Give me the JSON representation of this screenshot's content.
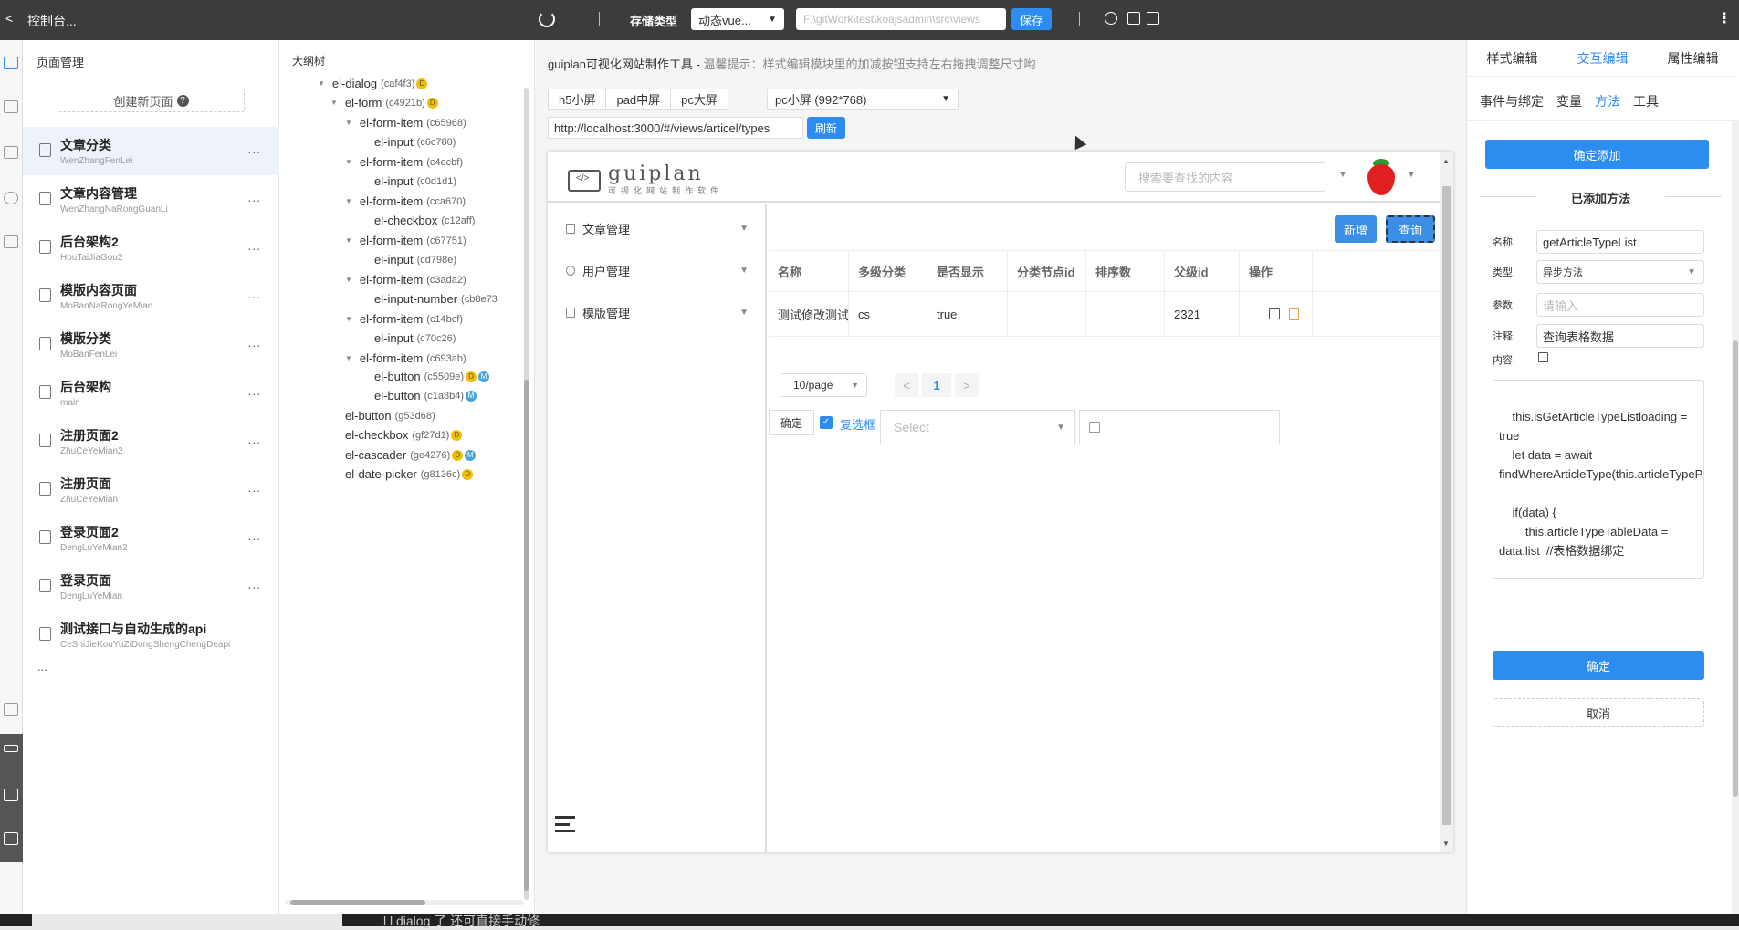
{
  "topbar": {
    "back": "<",
    "title": "控制台...",
    "storage_label": "存储类型",
    "storage_value": "动态vue...",
    "path_value": "F:\\gitWork\\test\\koajsadmin\\src\\views",
    "save": "保存",
    "more": "⋮"
  },
  "pages": {
    "title": "页面管理",
    "create": "创建新页面",
    "help": "?",
    "items": [
      {
        "name": "文章分类",
        "code": "WenZhangFenLei",
        "more": "..."
      },
      {
        "name": "文章内容管理",
        "code": "WenZhangNaRongGuanLi",
        "more": "..."
      },
      {
        "name": "后台架构2",
        "code": "HouTaiJiaGou2",
        "more": "..."
      },
      {
        "name": "模版内容页面",
        "code": "MoBanNaRongYeMian",
        "more": "..."
      },
      {
        "name": "模版分类",
        "code": "MoBanFenLei",
        "more": "..."
      },
      {
        "name": "后台架构",
        "code": "main",
        "more": "..."
      },
      {
        "name": "注册页面2",
        "code": "ZhuCeYeMian2",
        "more": "..."
      },
      {
        "name": "注册页面",
        "code": "ZhuCeYeMian",
        "more": "..."
      },
      {
        "name": "登录页面2",
        "code": "DengLuYeMian2",
        "more": "..."
      },
      {
        "name": "登录页面",
        "code": "DengLuYeMian",
        "more": "..."
      },
      {
        "name": "测试接口与自动生成的api",
        "code": "CeShiJieKouYuZiDongShengChengDeapi",
        "more": ""
      }
    ],
    "ellipsis": "..."
  },
  "tree": {
    "title": "大纲树",
    "nodes": [
      {
        "label": "el-dialog",
        "id": "(caf4f3)",
        "badges": [
          "D"
        ]
      },
      {
        "label": "el-form",
        "id": "(c4921b)",
        "badges": [
          "D"
        ]
      },
      {
        "label": "el-form-item",
        "id": "(c65968)",
        "badges": []
      },
      {
        "label": "el-input",
        "id": "(c6c780)",
        "badges": []
      },
      {
        "label": "el-form-item",
        "id": "(c4ecbf)",
        "badges": []
      },
      {
        "label": "el-input",
        "id": "(c0d1d1)",
        "badges": []
      },
      {
        "label": "el-form-item",
        "id": "(cca670)",
        "badges": []
      },
      {
        "label": "el-checkbox",
        "id": "(c12aff)",
        "badges": []
      },
      {
        "label": "el-form-item",
        "id": "(c67751)",
        "badges": []
      },
      {
        "label": "el-input",
        "id": "(cd798e)",
        "badges": []
      },
      {
        "label": "el-form-item",
        "id": "(c3ada2)",
        "badges": []
      },
      {
        "label": "el-input-number",
        "id": "(cb8e73",
        "badges": []
      },
      {
        "label": "el-form-item",
        "id": "(c14bcf)",
        "badges": []
      },
      {
        "label": "el-input",
        "id": "(c70c26)",
        "badges": []
      },
      {
        "label": "el-form-item",
        "id": "(c693ab)",
        "badges": []
      },
      {
        "label": "el-button",
        "id": "(c5509e)",
        "badges": [
          "D",
          "M"
        ]
      },
      {
        "label": "el-button",
        "id": "(c1a8b4)",
        "badges": [
          "M"
        ]
      },
      {
        "label": "el-button",
        "id": "(g53d68)",
        "badges": []
      },
      {
        "label": "el-checkbox",
        "id": "(gf27d1)",
        "badges": [
          "D"
        ]
      },
      {
        "label": "el-cascader",
        "id": "(ge4276)",
        "badges": [
          "D",
          "M"
        ]
      },
      {
        "label": "el-date-picker",
        "id": "(g8136c)",
        "badges": [
          "D"
        ]
      }
    ]
  },
  "canvas": {
    "tool_title": "guiplan可视化网站制作工具 - ",
    "hint": "温馨提示：样式编辑模块里的加减按钮支持左右拖拽调整尺寸哟",
    "device_tabs": [
      "h5小屏",
      "pad中屏",
      "pc大屏"
    ],
    "device_select": "pc小屏 (992*768)",
    "url": "http://localhost:3000/#/views/articel/types",
    "refresh": "刷新"
  },
  "preview": {
    "brand": "guiplan",
    "brand_sub": "可视化网站制作软件",
    "search_placeholder": "搜索要查找的内容",
    "menus": [
      "文章管理",
      "用户管理",
      "模版管理"
    ],
    "add": "新增",
    "query": "查询",
    "table": {
      "headers": [
        "名称",
        "多级分类",
        "是否显示",
        "分类节点id",
        "排序数",
        "父级id",
        "操作"
      ],
      "rows": [
        [
          "测试修改测试",
          "cs",
          "true",
          "",
          "",
          "2321",
          ""
        ]
      ]
    },
    "page_size": "10/page",
    "page_prev": "<",
    "page_current": "1",
    "page_next": ">",
    "confirm": "确定",
    "checkbox_label": "复选框",
    "select_placeholder": "Select"
  },
  "props": {
    "tabs": [
      "样式编辑",
      "交互编辑",
      "属性编辑"
    ],
    "active_tab": 1,
    "subtabs": [
      "事件与绑定",
      "变量",
      "方法",
      "工具"
    ],
    "active_subtab": 2,
    "confirm_add": "确定添加",
    "added_title": "已添加方法",
    "name_label": "名称:",
    "name_value": "getArticleTypeList",
    "type_label": "类型:",
    "type_value": "异步方法",
    "params_label": "参数:",
    "params_placeholder": "请输入",
    "comment_label": "注释:",
    "comment_value": "查询表格数据",
    "content_label": "内容:",
    "code": "\n    this.isGetArticleTypeListloading = true\n    let data = await findWhereArticleType(this.articleTypePages)\n\n    if(data) {\n        this.articleTypeTableData = data.list  //表格数据绑定",
    "ok": "确定",
    "cancel": "取消"
  },
  "taskbar": {
    "text": "l  l dialog 了  还可直接手动修"
  }
}
